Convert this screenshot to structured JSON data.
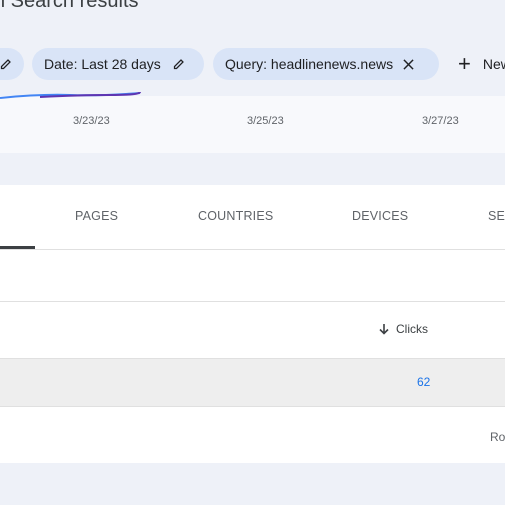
{
  "header": {
    "title": "n Search results"
  },
  "filters": {
    "date_chip": "Date: Last 28 days",
    "query_chip": "Query: headlinenews.news",
    "new_button": "New"
  },
  "chart_data": {
    "type": "line",
    "x_tick_labels": [
      "3/23/23",
      "3/25/23",
      "3/27/23"
    ],
    "series_colors": [
      "#4285f4",
      "#5e35b1"
    ]
  },
  "tabs": [
    "PAGES",
    "COUNTRIES",
    "DEVICES",
    "SE"
  ],
  "table": {
    "columns": {
      "clicks": "Clicks"
    },
    "rows": [
      {
        "clicks": "62"
      }
    ],
    "footer_label": "Ro"
  }
}
